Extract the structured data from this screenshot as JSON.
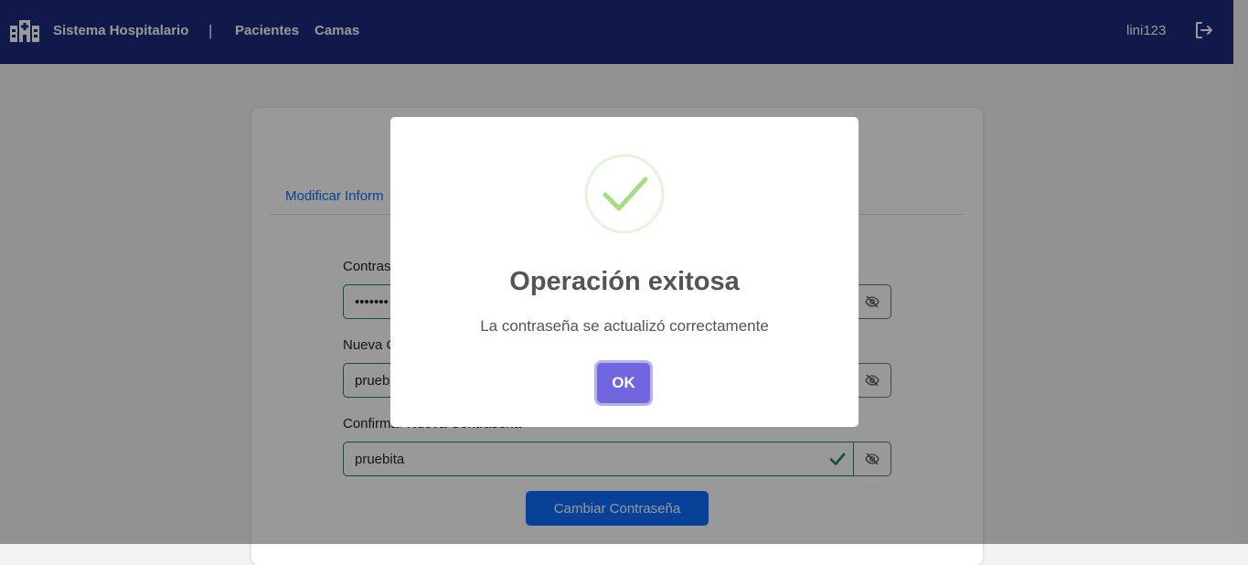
{
  "navbar": {
    "brand": "Sistema Hospitalario",
    "separator": "|",
    "links": [
      "Pacientes",
      "Camas"
    ],
    "username": "lini123"
  },
  "card": {
    "tab_label": "Modificar Inform",
    "fields": [
      {
        "label": "Contras",
        "value": "linette"
      },
      {
        "label": "Nueva C",
        "value": "prueb"
      },
      {
        "label": "Confirmar Nueva Contraseña",
        "value": "pruebita"
      }
    ],
    "submit_label": "Cambiar Contraseña"
  },
  "modal": {
    "title": "Operación exitosa",
    "message": "La contraseña se actualizó correctamente",
    "ok_label": "OK"
  },
  "colors": {
    "navbar": "#1b2a7a",
    "primary": "#0d6efd",
    "success_green": "#198754",
    "ok_button": "#7066e0",
    "check_green": "#a5dc86"
  },
  "icons": {
    "brand": "hospital-icon",
    "logout": "logout-icon",
    "eye": "eye-slash-icon",
    "success": "success-check-icon",
    "valid": "valid-check-icon"
  }
}
